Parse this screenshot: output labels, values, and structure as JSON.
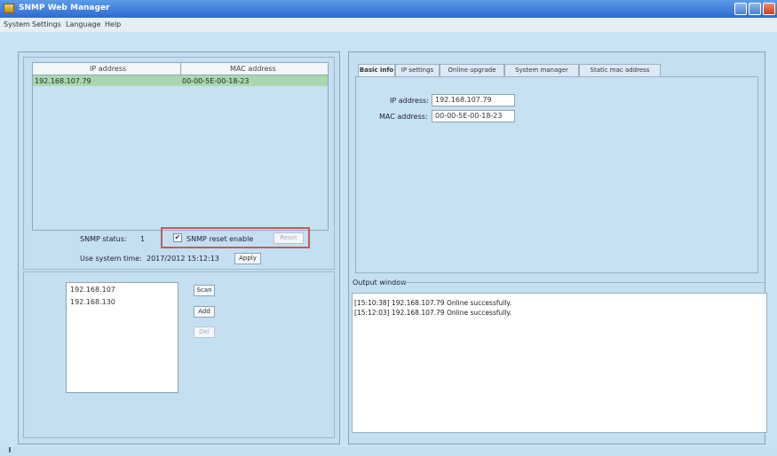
{
  "window": {
    "title": "SNMP Web Manager"
  },
  "menu": [
    "System",
    "Settings",
    "Language",
    "Help"
  ],
  "device_table": {
    "columns": [
      "IP address",
      "MAC address"
    ],
    "rows": [
      {
        "ip": "192.168.107.79",
        "mac": "00-00-5E-00-18-23"
      }
    ]
  },
  "snmp": {
    "status_label": "SNMP status:",
    "status_value": "1",
    "reset_enable_label": "SNMP reset enable",
    "reset_enable_checked": true,
    "reset_button": "Reset"
  },
  "system_time": {
    "label": "Use system time:",
    "value": "2017/2012 15:12:13",
    "apply_button": "Apply"
  },
  "scan_list": {
    "items": [
      "192.168.107",
      "192.168.130"
    ],
    "scan_button": "Scan",
    "add_button": "Add",
    "del_button": "Del"
  },
  "tabs": [
    "Basic info",
    "IP settings",
    "Online upgrade",
    "System manager",
    "Static mac address"
  ],
  "active_tab": "Basic info",
  "basic_info": {
    "ip_label": "IP address:",
    "ip_value": "192.168.107.79",
    "mac_label": "MAC address:",
    "mac_value": "00-00-5E-00-18-23"
  },
  "output": {
    "label": "Output window",
    "lines": [
      "[15:10:38]  192.168.107.79 Online successfully.",
      "[15:12:03]  192.168.107.79 Online successfully."
    ]
  },
  "colors": {
    "accent_titlebar": "#2f6ad0",
    "selected_row": "#a9d7b0",
    "highlight_box": "#c05b5b"
  }
}
